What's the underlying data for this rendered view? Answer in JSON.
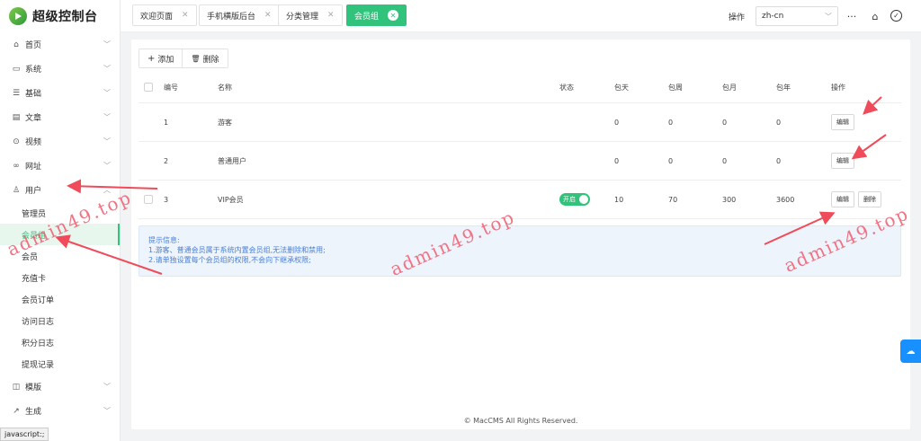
{
  "app": {
    "title": "超级控制台"
  },
  "sidebar": {
    "items": [
      {
        "label": "首页",
        "icon": "home-icon",
        "glyph": "⌂"
      },
      {
        "label": "系统",
        "icon": "monitor-icon",
        "glyph": "▭"
      },
      {
        "label": "基础",
        "icon": "list-icon",
        "glyph": "☰"
      },
      {
        "label": "文章",
        "icon": "article-icon",
        "glyph": "▤"
      },
      {
        "label": "视频",
        "icon": "play-icon",
        "glyph": "⊙"
      },
      {
        "label": "网址",
        "icon": "link-icon",
        "glyph": "∞"
      },
      {
        "label": "用户",
        "icon": "user-icon",
        "glyph": "♙"
      }
    ],
    "user_sub": [
      "管理员",
      "会员组",
      "会员",
      "充值卡",
      "会员订单",
      "访问日志",
      "积分日志",
      "提现记录"
    ],
    "bottom_items": [
      {
        "label": "模版",
        "icon": "template-icon",
        "glyph": "◫"
      },
      {
        "label": "生成",
        "icon": "generate-icon",
        "glyph": "↗"
      }
    ]
  },
  "tabs": [
    {
      "label": "欢迎页面",
      "close": "✕"
    },
    {
      "label": "手机横版后台",
      "close": "✕"
    },
    {
      "label": "分类管理",
      "close": "✕"
    },
    {
      "label": "会员组",
      "close": "✕"
    }
  ],
  "header": {
    "op_label": "操作",
    "lang": "zh-cn",
    "more_glyph": "···",
    "home_glyph": "⌂",
    "check_glyph": "✓"
  },
  "toolbar": {
    "add_label": "添加",
    "add_glyph": "+",
    "delete_label": "删除",
    "delete_glyph": "🗑"
  },
  "table": {
    "headers": {
      "id": "编号",
      "name": "名称",
      "status": "状态",
      "day": "包天",
      "week": "包周",
      "month": "包月",
      "year": "包年",
      "ops": "操作"
    },
    "rows": [
      {
        "id": "1",
        "name": "游客",
        "status": "",
        "day": "0",
        "week": "0",
        "month": "0",
        "year": "0",
        "edit": "编辑",
        "del": ""
      },
      {
        "id": "2",
        "name": "普通用户",
        "status": "",
        "day": "0",
        "week": "0",
        "month": "0",
        "year": "0",
        "edit": "编辑",
        "del": ""
      },
      {
        "id": "3",
        "name": "VIP会员",
        "status": "开启",
        "day": "10",
        "week": "70",
        "month": "300",
        "year": "3600",
        "edit": "编辑",
        "del": "删除"
      }
    ]
  },
  "tip": {
    "title": "提示信息:",
    "line1": "1.游客、普通会员属于系统内置会员组,无法删除和禁用;",
    "line2": "2.请单独设置每个会员组的权限,不会向下继承权限;"
  },
  "footer": {
    "text": "© MacCMS All Rights Reserved."
  },
  "status_bar": {
    "text": "javascript:;"
  },
  "watermark": {
    "text": "admin49.top"
  },
  "colors": {
    "accent": "#31c27c",
    "tip_text": "#4a7fd4",
    "arrow": "#f04b5a",
    "float": "#1890ff"
  }
}
